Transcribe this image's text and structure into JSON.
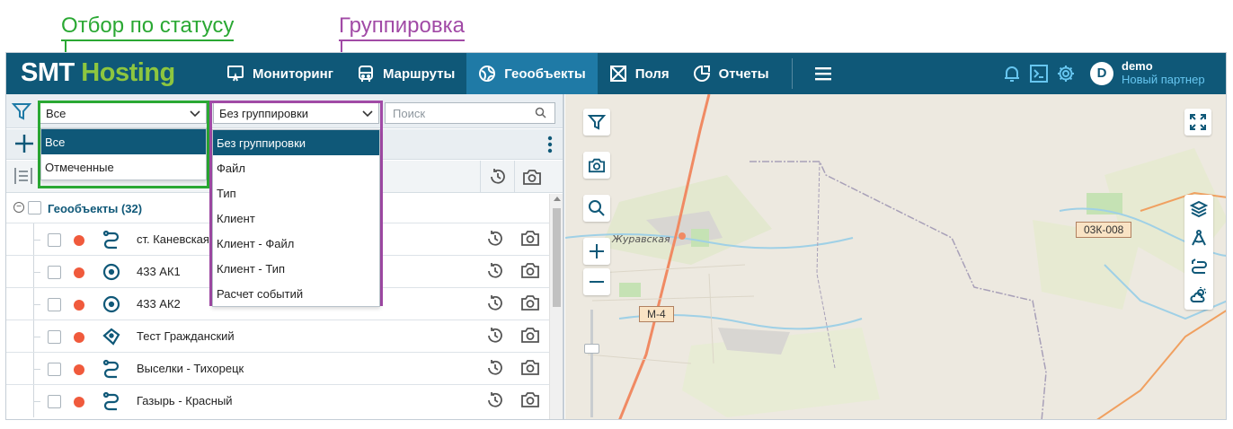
{
  "annotations": {
    "status_filter": "Отбор по статусу",
    "grouping": "Группировка"
  },
  "brand": {
    "smt": "SMT",
    "hosting": "Hosting"
  },
  "nav": [
    {
      "label": "Мониторинг",
      "icon": "monitor-icon"
    },
    {
      "label": "Маршруты",
      "icon": "bus-icon"
    },
    {
      "label": "Геообъекты",
      "icon": "globe-icon",
      "active": true
    },
    {
      "label": "Поля",
      "icon": "field-icon"
    },
    {
      "label": "Отчеты",
      "icon": "reports-icon"
    }
  ],
  "user": {
    "initial": "D",
    "name": "demo",
    "role": "Новый партнер"
  },
  "filters": {
    "status_value": "Все",
    "grouping_value": "Без группировки",
    "search_placeholder": "Поиск"
  },
  "status_options": [
    "Все",
    "Отмеченные"
  ],
  "grouping_options": [
    "Без группировки",
    "Файл",
    "Тип",
    "Клиент",
    "Клиент - Файл",
    "Клиент - Тип",
    "Расчет событий"
  ],
  "list": {
    "group_label": "Геообъекты (32)",
    "rows": [
      {
        "name": "ст. Каневская",
        "type": "route-icon"
      },
      {
        "name": "433 АК1",
        "type": "target-icon"
      },
      {
        "name": "433 АК2",
        "type": "target-icon"
      },
      {
        "name": "Тест Гражданский",
        "type": "polygon-icon"
      },
      {
        "name": "Выселки - Тихорецк",
        "type": "route-icon"
      },
      {
        "name": "Газырь - Красный",
        "type": "route-icon"
      }
    ]
  },
  "map": {
    "place_label": "Журавская",
    "road_m4": "М-4",
    "road_03k": "03К-008"
  },
  "colors": {
    "topbar": "#0f5878",
    "active_tab": "#1f7aa6",
    "brand_green": "#8dc63f",
    "status_dot": "#f05a3c",
    "annot_green": "#2aa833",
    "annot_purple": "#a14aa6"
  }
}
